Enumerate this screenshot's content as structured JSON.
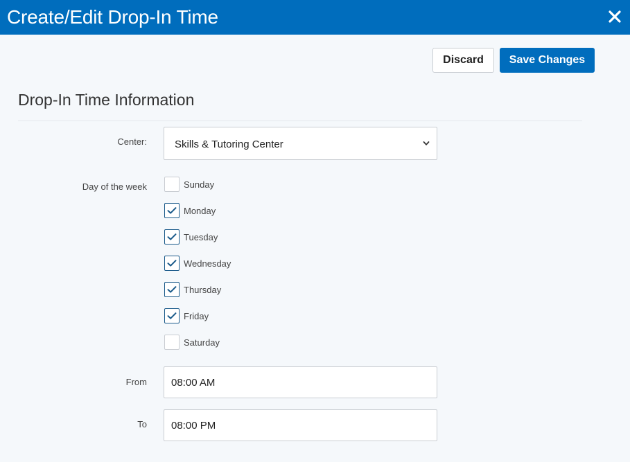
{
  "header": {
    "title": "Create/Edit Drop-In Time",
    "close_icon": "close-icon"
  },
  "toolbar": {
    "discard_label": "Discard",
    "save_label": "Save Changes"
  },
  "section": {
    "title": "Drop-In Time Information"
  },
  "form": {
    "center_label": "Center:",
    "center_value": "Skills & Tutoring Center",
    "day_label": "Day of the week",
    "days": [
      {
        "label": "Sunday",
        "checked": false
      },
      {
        "label": "Monday",
        "checked": true
      },
      {
        "label": "Tuesday",
        "checked": true
      },
      {
        "label": "Wednesday",
        "checked": true
      },
      {
        "label": "Thursday",
        "checked": true
      },
      {
        "label": "Friday",
        "checked": true
      },
      {
        "label": "Saturday",
        "checked": false
      }
    ],
    "from_label": "From",
    "from_value": "08:00 AM",
    "to_label": "To",
    "to_value": "08:00 PM"
  },
  "colors": {
    "brand": "#006dbd",
    "check": "#1a5a8a"
  }
}
